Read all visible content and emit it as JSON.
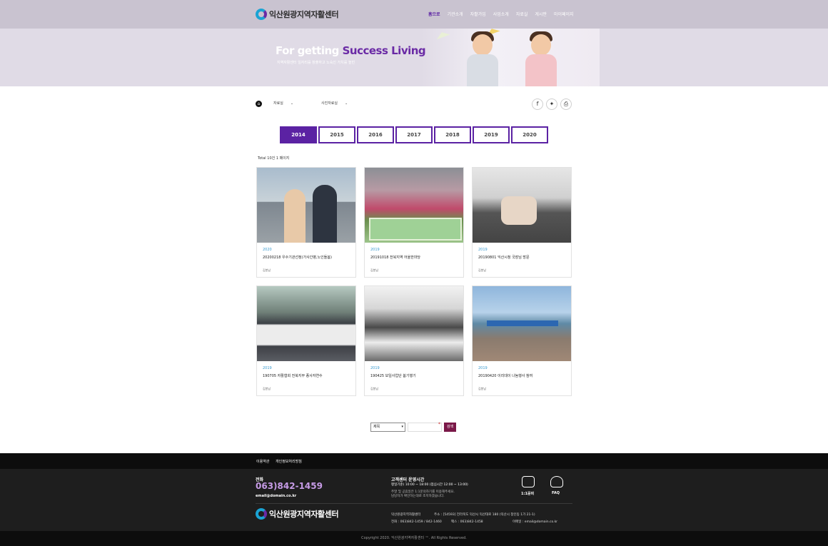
{
  "header": {
    "logo_text": "익산원광지역자활센터",
    "nav": [
      "홈으로",
      "기관소개",
      "자활가입",
      "사업소개",
      "자료실",
      "게시판",
      "마이페이지"
    ]
  },
  "hero": {
    "title_plain": "For getting ",
    "title_accent": "Success Living",
    "subtitle": "지역자활센터 일자리를 창출하고 노숙인 가치를 높힌"
  },
  "breadcrumb": {
    "level1": "자료실",
    "level2": "사진자료실"
  },
  "years": [
    "2014",
    "2015",
    "2016",
    "2017",
    "2018",
    "2019",
    "2020"
  ],
  "active_year": "2014",
  "list": {
    "total_text": "Total 10건 1 페이지"
  },
  "cards": [
    {
      "year": "2020",
      "title": "20200218 우수기관선정(가사간병,노인돌봄)",
      "author": "김봉남"
    },
    {
      "year": "2019",
      "title": "20191018 전북지역 어울한마당",
      "author": "김봉남"
    },
    {
      "year": "2019",
      "title": "20190801 익산시청 국장님 방문",
      "author": "김봉남"
    },
    {
      "year": "2019",
      "title": "190705 자활협회 전북지부 종사자연수",
      "author": "김봉남"
    },
    {
      "year": "2019",
      "title": "190425 보일사업단 봄기행기",
      "author": "김봉남"
    },
    {
      "year": "2019",
      "title": "20190420 이리데이 나눔행사 참여",
      "author": "김봉남"
    }
  ],
  "search": {
    "select_value": "제목",
    "button_label": "검색"
  },
  "footer": {
    "links": [
      "이용약관",
      "개인정보처리방침"
    ],
    "phone_label": "전화",
    "phone": "063)842-1459",
    "email": "email@domain.co.kr",
    "hours_title": "고객센터 운영시간",
    "hours": "평일기준) 10:00 ~ 18:00 (점심시간 12:00 ~ 13:00)",
    "hours_note1": "주말 및 공휴일은 1:1문의하기를 이용해주세요.",
    "hours_note2": "담당자가 확인하는대로 조치하겠습니다.",
    "inquiry_label": "1:1문의",
    "faq_label": "FAQ",
    "org_name": "익산원광지역자활센터",
    "address": "주소 : [54593] 전라북도 익산시 익산대로 180 (익산시 창인동 1가 21-1)",
    "tel": "전화 : 063)842-1459 / 842-1460",
    "fax": "팩스 : 063)842-1458",
    "email_line": "이메일 : email@domain.co.kr",
    "logo_text": "익산원광지역자활센터",
    "copyright": "Copyright 2020. 익산원광지역자활센터 ™. All Rights Reserved."
  }
}
